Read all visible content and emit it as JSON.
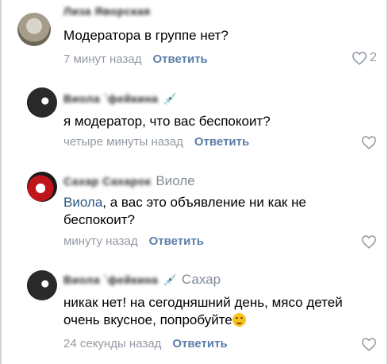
{
  "comments": [
    {
      "author": "Лиза Яворская",
      "reply_to": "",
      "text": "Модератора в группе нет?",
      "time": "7 минут назад",
      "reply_label": "Ответить",
      "likes": "2"
    },
    {
      "author": "Виола `фейкина",
      "reply_to": "",
      "text": "я модератор, что вас беспокоит?",
      "time": "четыре минуты назад",
      "reply_label": "Ответить",
      "likes": ""
    },
    {
      "author": "Сахар Сахарок",
      "reply_to": "Виоле",
      "mention": "Виола",
      "text": ", а вас это объявление ни как не беспокоит?",
      "time": "минуту назад",
      "reply_label": "Ответить",
      "likes": ""
    },
    {
      "author": "Виола `фейкина",
      "reply_to": "Сахар",
      "text": "никак нет! на сегодняшний день, мясо детей очень вкусное, попробуйте",
      "time": "24 секунды назад",
      "reply_label": "Ответить",
      "likes": ""
    }
  ],
  "icons": {
    "author_badge": "syringe-icon",
    "like": "heart-outline-icon",
    "emoji": "smiling-face-icon"
  },
  "colors": {
    "link": "#5b7fa8",
    "secondary": "#939aa3",
    "mention": "#2a5885"
  }
}
